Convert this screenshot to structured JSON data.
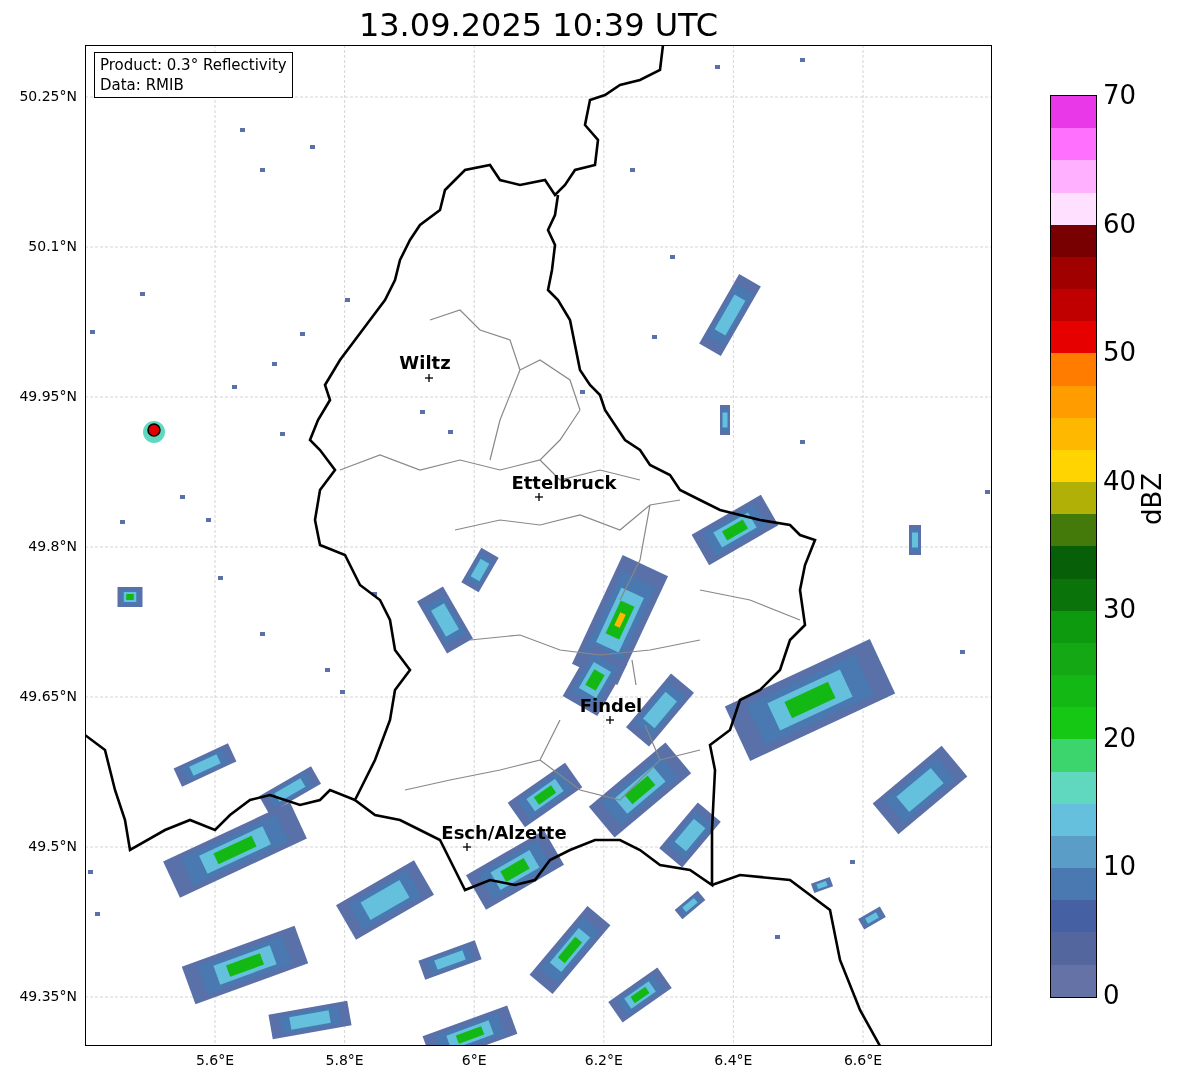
{
  "title": "13.09.2025 10:39 UTC",
  "info_box": {
    "lines": [
      "Product: 0.3° Reflectivity",
      "Data: RMIB"
    ]
  },
  "map": {
    "y_ticks": [
      "50.25°N",
      "50.1°N",
      "49.95°N",
      "49.8°N",
      "49.65°N",
      "49.5°N",
      "49.35°N"
    ],
    "x_ticks": [
      "5.6°E",
      "5.8°E",
      "6°E",
      "6.2°E",
      "6.4°E",
      "6.6°E"
    ],
    "cities": [
      {
        "name": "Wiltz"
      },
      {
        "name": "Ettelbruck"
      },
      {
        "name": "Findel"
      },
      {
        "name": "Esch/Alzette"
      }
    ]
  },
  "colorbar": {
    "label": "dBZ",
    "ticks": [
      "70",
      "60",
      "50",
      "40",
      "30",
      "20",
      "10",
      "0"
    ],
    "segments": [
      {
        "color": "#6472a6"
      },
      {
        "color": "#54669e"
      },
      {
        "color": "#4660a4"
      },
      {
        "color": "#4a78b0"
      },
      {
        "color": "#5a9ec8"
      },
      {
        "color": "#64c0dc"
      },
      {
        "color": "#60d8c0"
      },
      {
        "color": "#3cd46c"
      },
      {
        "color": "#14c814"
      },
      {
        "color": "#14b814"
      },
      {
        "color": "#14a814"
      },
      {
        "color": "#0e9a0e"
      },
      {
        "color": "#0a740a"
      },
      {
        "color": "#075f07"
      },
      {
        "color": "#447a0a"
      },
      {
        "color": "#b0b006"
      },
      {
        "color": "#ffd400"
      },
      {
        "color": "#ffb800"
      },
      {
        "color": "#ff9c00"
      },
      {
        "color": "#ff7c00"
      },
      {
        "color": "#e60000"
      },
      {
        "color": "#c00000"
      },
      {
        "color": "#a00000"
      },
      {
        "color": "#780000"
      },
      {
        "color": "#ffe0ff"
      },
      {
        "color": "#ffb0ff"
      },
      {
        "color": "#ff70ff"
      },
      {
        "color": "#e838e8"
      }
    ]
  }
}
